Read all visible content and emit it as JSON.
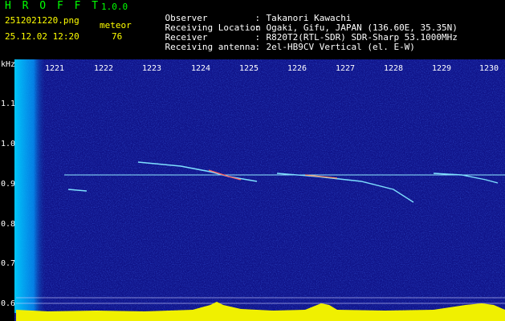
{
  "header": {
    "title": "H R O F F T",
    "version": "1.0.0",
    "filename": "2512021220.png",
    "datetime": "25.12.02 12:20",
    "meteor_label": "meteor",
    "meteor_count": "76"
  },
  "info": [
    {
      "key": "Observer",
      "sep": ":",
      "value": "Takanori Kawachi"
    },
    {
      "key": "Receiving Location",
      "sep": ":",
      "value": "Ogaki, Gifu, JAPAN (136.60E, 35.35N)"
    },
    {
      "key": "Receiver",
      "sep": ":",
      "value": "R820T2(RTL-SDR) SDR-Sharp 53.1000MHz"
    },
    {
      "key": "Receiving antenna",
      "sep": ":",
      "value": "2el-HB9CV Vertical (el. E-W)"
    }
  ],
  "axes": {
    "y_unit": "kHz",
    "x_ticks": [
      "1221",
      "1222",
      "1223",
      "1224",
      "1225",
      "1226",
      "1227",
      "1228",
      "1229",
      "1230"
    ],
    "y_ticks": [
      "1.1",
      "1.0",
      "0.9",
      "0.8",
      "0.7",
      "0.6"
    ]
  },
  "colors": {
    "background": "#000000",
    "spectrogram_bg": "#10148a",
    "green_text": "#00ff00",
    "yellow_text": "#ffff00",
    "trail": "#7fe0ff",
    "noise_band": "#00c0ff"
  }
}
